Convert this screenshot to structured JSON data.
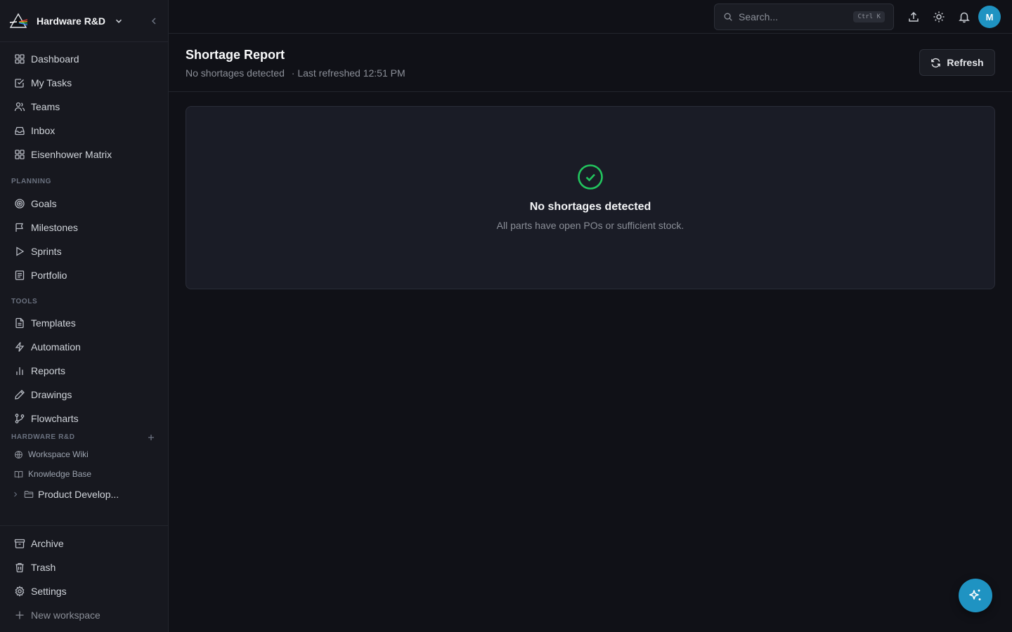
{
  "workspace": {
    "name": "Hardware R&D"
  },
  "nav_main": [
    {
      "label": "Dashboard",
      "icon": "dashboard-icon"
    },
    {
      "label": "My Tasks",
      "icon": "task-check-icon"
    },
    {
      "label": "Teams",
      "icon": "users-icon"
    },
    {
      "label": "Inbox",
      "icon": "inbox-icon"
    },
    {
      "label": "Eisenhower Matrix",
      "icon": "grid-icon"
    }
  ],
  "planning": {
    "label": "PLANNING",
    "items": [
      {
        "label": "Goals",
        "icon": "target-icon"
      },
      {
        "label": "Milestones",
        "icon": "flag-icon"
      },
      {
        "label": "Sprints",
        "icon": "play-icon"
      },
      {
        "label": "Portfolio",
        "icon": "portfolio-icon"
      }
    ]
  },
  "tools": {
    "label": "TOOLS",
    "items": [
      {
        "label": "Templates",
        "icon": "file-icon"
      },
      {
        "label": "Automation",
        "icon": "bolt-icon"
      },
      {
        "label": "Reports",
        "icon": "bar-chart-icon"
      },
      {
        "label": "Drawings",
        "icon": "pen-icon"
      },
      {
        "label": "Flowcharts",
        "icon": "git-branch-icon"
      }
    ]
  },
  "workspace_section": {
    "label": "HARDWARE R&D",
    "items": [
      {
        "label": "Workspace Wiki",
        "icon": "globe-icon"
      },
      {
        "label": "Knowledge Base",
        "icon": "book-icon"
      }
    ],
    "folder": {
      "label": "Product Develop...",
      "icon": "folder-icon"
    }
  },
  "nav_bottom": [
    {
      "label": "Archive",
      "icon": "archive-icon"
    },
    {
      "label": "Trash",
      "icon": "trash-icon"
    },
    {
      "label": "Settings",
      "icon": "gear-icon"
    },
    {
      "label": "New workspace",
      "icon": "plus-icon"
    }
  ],
  "topbar": {
    "search_placeholder": "Search...",
    "search_shortcut": "Ctrl K",
    "avatar_initial": "M"
  },
  "page": {
    "title": "Shortage Report",
    "status": "No shortages detected",
    "refreshed": "· Last refreshed 12:51 PM",
    "refresh_label": "Refresh"
  },
  "empty_state": {
    "title": "No shortages detected",
    "description": "All parts have open POs or sufficient stock."
  },
  "colors": {
    "accent": "#1f93c2",
    "success": "#22c55e",
    "background": "#101117",
    "sidebar": "#17181f"
  }
}
